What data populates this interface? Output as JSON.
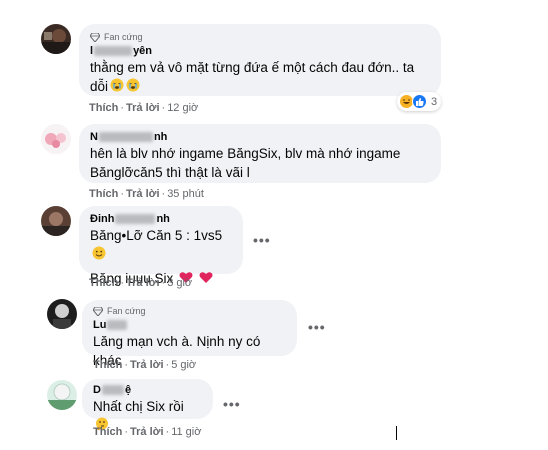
{
  "comments": [
    {
      "badge": "Fan cứng",
      "name_prefix": "l",
      "name_suffix": "yên",
      "text": "thằng em vả vô mặt từng đứa ế một cách đau đớn.. ta\ndỗi",
      "emoji": [
        "crying-face-icon",
        "crying-face-icon"
      ],
      "action_like": "Thích",
      "action_reply": "Trả lời",
      "time": "12 giờ",
      "reactions": {
        "icons": [
          "haha-icon",
          "like-icon"
        ],
        "count": "3"
      }
    },
    {
      "name_prefix": "N",
      "name_suffix": "nh",
      "text": "hên là blv nhớ ingame BăngSix, blv mà nhớ ingame\nBănglỡcăn5 thì thật là vãi l",
      "action_like": "Thích",
      "action_reply": "Trả lời",
      "time": "35 phút"
    },
    {
      "name_prefix": "Đinh",
      "name_suffix": "nh",
      "line1": "Băng•Lỡ Căn 5 : 1vs5",
      "line2": "Băng iuuu Six",
      "action_like": "Thích",
      "action_reply": "Trả lời",
      "time": "3 giờ"
    },
    {
      "badge": "Fan cứng",
      "name_prefix": "Lu",
      "name_suffix": "",
      "text": "Lăng mạn vch à. Nịnh ny có khác",
      "action_like": "Thích",
      "action_reply": "Trả lời",
      "time": "5 giờ"
    },
    {
      "name_prefix": "D",
      "name_suffix": "ệ",
      "text": "Nhất chị Six rồi",
      "action_like": "Thích",
      "action_reply": "Trả lời",
      "time": "11 giờ"
    }
  ],
  "more_icon": "•••",
  "colors": {
    "bubble": "#f0f2f5",
    "meta": "#65676b",
    "heart": "#e0245e",
    "like": "#1877f2",
    "haha": "#f7b125"
  }
}
